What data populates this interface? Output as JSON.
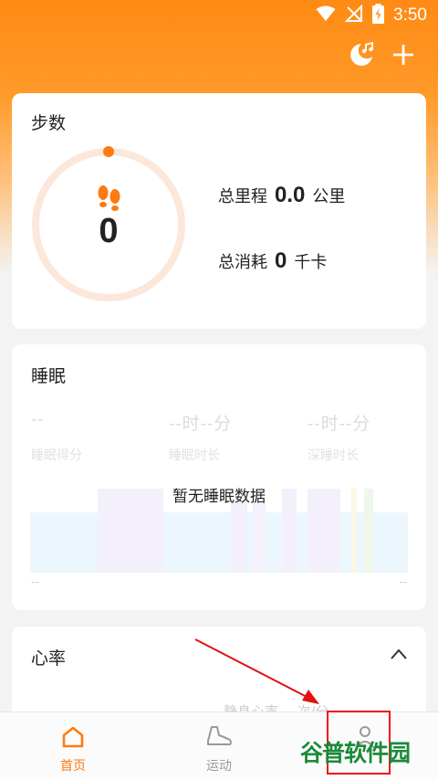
{
  "status_bar": {
    "time": "3:50"
  },
  "colors": {
    "accent": "#ff7a0f",
    "ring_bg": "#fbe7d9",
    "annotation": "#e11111",
    "watermark": "#1a8a3a"
  },
  "steps_card": {
    "title": "步数",
    "steps": "0",
    "total_distance_label": "总里程",
    "total_distance_value": "0.0",
    "total_distance_unit": "公里",
    "calories_label": "总消耗",
    "calories_value": "0",
    "calories_unit": "千卡",
    "ring_progress": 0.0
  },
  "sleep_card": {
    "title": "睡眠",
    "score_value": "--",
    "score_label": "睡眠得分",
    "duration_value": "--时--分",
    "duration_label": "睡眠时长",
    "deep_value": "--时--分",
    "deep_label": "深睡时长",
    "empty_message": "暂无睡眠数据",
    "axis_start": "--",
    "axis_end": "--"
  },
  "heart_card": {
    "title": "心率",
    "rest_label": "静息心率",
    "rest_value": "-- 次/分"
  },
  "nav": {
    "home_label": "首页",
    "sport_label": "运动"
  },
  "watermark_text": "谷普软件园",
  "icons": {
    "wifi": "wifi-icon",
    "signal": "signal-off-icon",
    "battery": "battery-charging-icon",
    "night_music": "moon-music-icon",
    "add": "plus-icon",
    "footprints": "footprints-icon",
    "chevron": "chevron-up-icon",
    "home": "home-icon",
    "sport": "shoe-icon",
    "me": "person-icon"
  }
}
